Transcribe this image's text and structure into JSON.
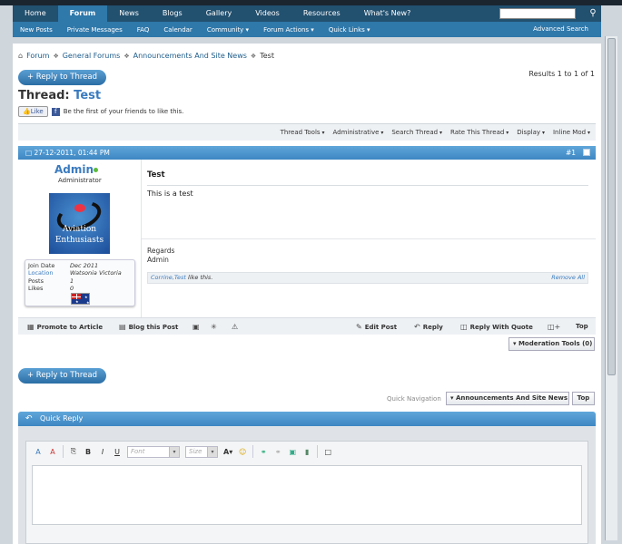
{
  "nav": {
    "tabs": [
      "Home",
      "Forum",
      "News",
      "Blogs",
      "Gallery",
      "Videos",
      "Resources",
      "What's New?"
    ],
    "active_tab": "Forum",
    "subnav": [
      "New Posts",
      "Private Messages",
      "FAQ",
      "Calendar",
      "Community ▾",
      "Forum Actions ▾",
      "Quick Links ▾"
    ],
    "advanced_search": "Advanced Search"
  },
  "breadcrumb": {
    "items": [
      "Forum",
      "General Forums",
      "Announcements And Site News"
    ],
    "current": "Test"
  },
  "actions": {
    "reply_label": "+ Reply to Thread",
    "results": "Results 1 to 1 of 1"
  },
  "thread": {
    "prefix": "Thread:",
    "name": "Test",
    "like_label": "Like",
    "like_text": "Be the first of your friends to like this."
  },
  "thread_tools": [
    "Thread Tools",
    "Administrative",
    "Search Thread",
    "Rate This Thread",
    "Display",
    "Inline Mod"
  ],
  "post": {
    "date": "27-12-2011, 01:44 PM",
    "number": "#1",
    "username": "Admin",
    "user_title": "Administrator",
    "avatar_text_1": "Aviation",
    "avatar_text_2": "Enthusiasts",
    "stats": {
      "join_label": "Join Date",
      "join_value": "Dec 2011",
      "location_label": "Location",
      "location_value": "Watsonia Victoria",
      "posts_label": "Posts",
      "posts_value": "1",
      "likes_label": "Likes",
      "likes_value": "0"
    },
    "title": "Test",
    "text": "This is a test",
    "signature_1": "Regards",
    "signature_2": "Admin",
    "likes_who": "Corrine,Test",
    "likes_suffix": " like this.",
    "remove_all": "Remove All"
  },
  "post_footer": {
    "promote": "Promote to Article",
    "blog": "Blog this Post",
    "edit": "Edit Post",
    "reply": "Reply",
    "reply_quote": "Reply With Quote",
    "top": "Top"
  },
  "moderation": {
    "label": "Moderation Tools (0)"
  },
  "quick_nav": {
    "label": "Quick Navigation",
    "selected": "Announcements And Site News",
    "top": "Top"
  },
  "quick_reply": {
    "title": "Quick Reply",
    "font_placeholder": "Font",
    "size_placeholder": "Size"
  },
  "colors": {
    "nav_dark": "#22506f",
    "nav_light": "#2f78aa",
    "link": "#3a7bbf",
    "header_gradient": "#4a96d0"
  }
}
